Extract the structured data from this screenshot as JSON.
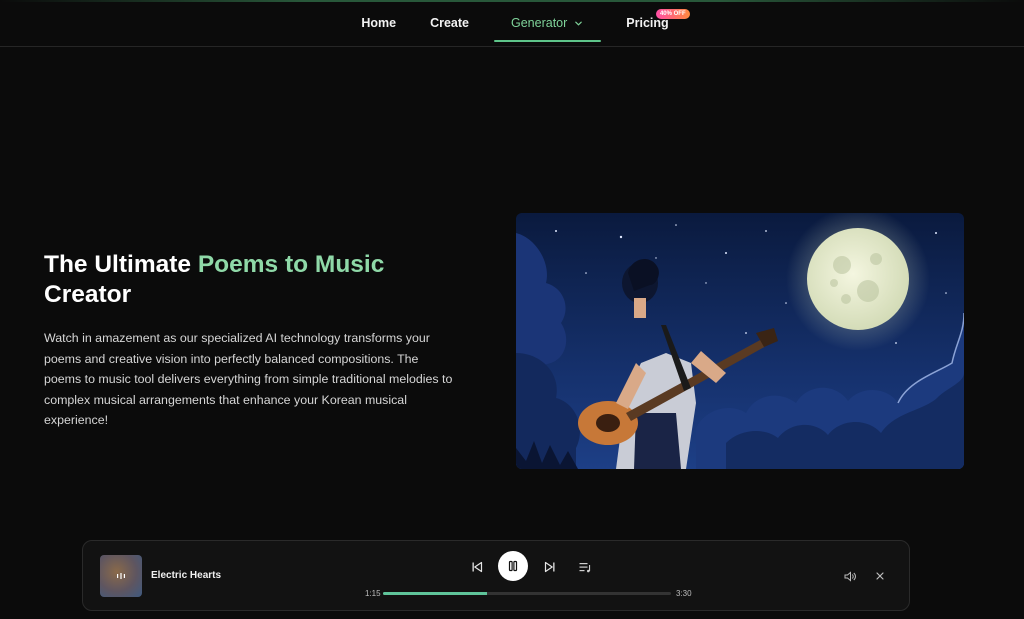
{
  "nav": {
    "items": [
      {
        "label": "Home"
      },
      {
        "label": "Create"
      },
      {
        "label": "Generator"
      },
      {
        "label": "Pricing",
        "badge": "40% OFF"
      }
    ],
    "active_index": 2
  },
  "hero": {
    "title_part1": "The Ultimate ",
    "title_accent": "Poems to Music",
    "title_part2": "Creator",
    "description": "Watch in amazement as our specialized AI technology transforms your poems and creative vision into perfectly balanced compositions. The poems to music tool delivers everything from simple traditional melodies to complex musical arrangements that enhance your Korean musical experience!"
  },
  "player": {
    "track_title": "Electric Hearts",
    "current_time": "1:15",
    "total_time": "3:30",
    "progress": 0.36
  },
  "colors": {
    "accent": "#8fd9a8",
    "progress": "#5fc49a",
    "background": "#0b0b0b"
  },
  "icons": {
    "prev": "skip-previous-icon",
    "pause": "pause-icon",
    "next": "skip-next-icon",
    "queue": "playlist-icon",
    "volume": "volume-icon",
    "close": "close-icon"
  }
}
